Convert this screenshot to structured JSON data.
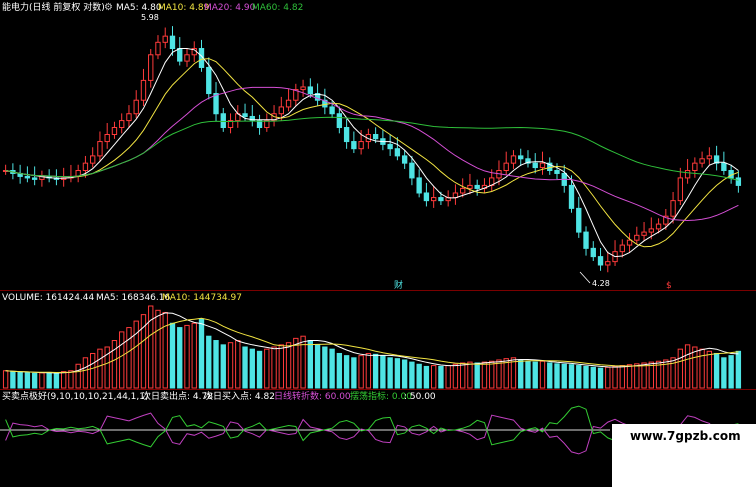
{
  "colors": {
    "background": "#000000",
    "up": "#ff3b3b",
    "down": "#4fe4e4",
    "ma5": "#ffffff",
    "ma10": "#f2e442",
    "ma20": "#d44fd4",
    "ma60": "#2fbf3a",
    "panel_line": "#7a0000",
    "osc_line1": "#c040c0",
    "osc_line2": "#33cc33",
    "osc_ref": "#dddddd",
    "watermark_bg": "#ffffff",
    "watermark_fg": "#000000"
  },
  "price_panel": {
    "title": "能电力(日线 前复权 对数)",
    "indicator_icon": "gear-icon",
    "ma_labels": [
      {
        "key": "ma5",
        "text": "MA5: 4.80"
      },
      {
        "key": "ma10",
        "text": "MA10: 4.89"
      },
      {
        "key": "ma20",
        "text": "MA20: 4.90"
      },
      {
        "key": "ma60",
        "text": "MA60: 4.82"
      }
    ],
    "high_marker": "5.98",
    "low_marker": "4.28",
    "event_markers": [
      "财",
      "$"
    ]
  },
  "volume_panel": {
    "title": "VOLUME: 161424.44",
    "labels": [
      {
        "key": "ma5",
        "text": "MA5: 168346.16"
      },
      {
        "key": "ma10",
        "text": "MA10: 144734.97"
      }
    ]
  },
  "oscillator_panel": {
    "title": "买卖点极好(9,10,10,10,21,44,1,1)",
    "labels": [
      {
        "key": "white",
        "text": "次日卖出点: 4.78"
      },
      {
        "key": "white",
        "text": "次日买入点: 4.82"
      },
      {
        "key": "purple",
        "text": "日线转折数: 60.00"
      },
      {
        "key": "green",
        "text": "摆荡指标: 0.00"
      },
      {
        "key": "white",
        "text": ": 50.00"
      }
    ]
  },
  "watermark": "www.7gpzb.com",
  "chart_data": {
    "type": "candlestick",
    "scale": "log",
    "ylim": [
      4.2,
      6.05
    ],
    "price_range_labels": {
      "high": 5.98,
      "low": 4.28
    },
    "ma_last": {
      "MA5": 4.8,
      "MA10": 4.89,
      "MA20": 4.9,
      "MA60": 4.82
    },
    "volume_last": 161424.44,
    "volume_ma_last": {
      "MA5": 168346.16,
      "MA10": 144734.97
    },
    "oscillator_reference": 50.0,
    "closes": [
      4.9,
      4.88,
      4.86,
      4.85,
      4.84,
      4.86,
      4.85,
      4.84,
      4.85,
      4.86,
      4.9,
      4.95,
      5.0,
      5.1,
      5.15,
      5.2,
      5.25,
      5.3,
      5.4,
      5.55,
      5.75,
      5.85,
      5.9,
      5.8,
      5.7,
      5.75,
      5.8,
      5.65,
      5.45,
      5.3,
      5.2,
      5.25,
      5.3,
      5.28,
      5.25,
      5.2,
      5.25,
      5.3,
      5.35,
      5.4,
      5.48,
      5.5,
      5.45,
      5.4,
      5.35,
      5.3,
      5.2,
      5.1,
      5.05,
      5.1,
      5.15,
      5.12,
      5.08,
      5.05,
      5.0,
      4.95,
      4.85,
      4.75,
      4.7,
      4.72,
      4.7,
      4.72,
      4.75,
      4.78,
      4.8,
      4.78,
      4.8,
      4.85,
      4.9,
      4.95,
      5.0,
      4.98,
      4.95,
      4.92,
      4.95,
      4.9,
      4.88,
      4.8,
      4.65,
      4.5,
      4.4,
      4.35,
      4.3,
      4.32,
      4.38,
      4.42,
      4.45,
      4.48,
      4.5,
      4.52,
      4.55,
      4.6,
      4.7,
      4.85,
      4.9,
      4.95,
      4.98,
      5.0,
      4.95,
      4.9,
      4.85,
      4.8
    ],
    "volumes": [
      40,
      38,
      36,
      35,
      34,
      35,
      36,
      34,
      38,
      40,
      55,
      70,
      80,
      90,
      95,
      110,
      130,
      140,
      155,
      170,
      190,
      180,
      175,
      150,
      140,
      145,
      150,
      160,
      120,
      110,
      100,
      105,
      110,
      95,
      90,
      85,
      90,
      95,
      100,
      105,
      115,
      120,
      110,
      100,
      95,
      90,
      80,
      75,
      70,
      75,
      80,
      78,
      75,
      70,
      68,
      65,
      60,
      55,
      50,
      52,
      50,
      52,
      55,
      58,
      60,
      58,
      60,
      62,
      65,
      68,
      70,
      65,
      62,
      60,
      62,
      58,
      56,
      55,
      54,
      52,
      50,
      48,
      46,
      48,
      50,
      52,
      54,
      56,
      58,
      60,
      62,
      65,
      70,
      90,
      100,
      95,
      90,
      85,
      80,
      70,
      75,
      85
    ]
  }
}
